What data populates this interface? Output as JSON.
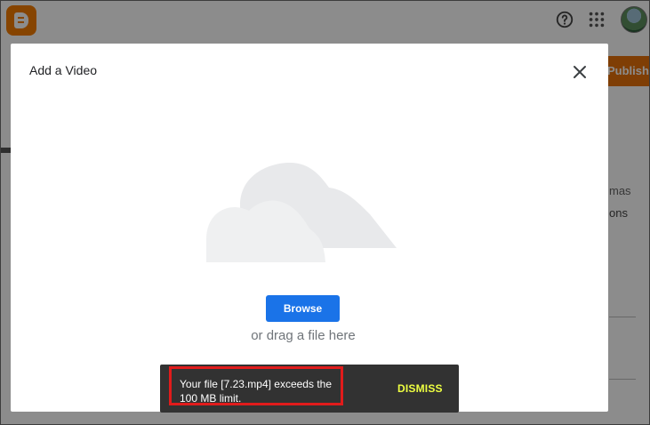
{
  "background": {
    "publish_label": "Publish",
    "partial_text_1": "mas",
    "partial_text_2": "ons"
  },
  "icons": {
    "help": "help-circle-icon",
    "apps": "apps-grid-icon",
    "close": "close-icon",
    "cloud": "cloud-upload-illustration"
  },
  "dialog": {
    "title": "Add a Video",
    "browse_label": "Browse",
    "drag_text": "or drag a file here"
  },
  "snackbar": {
    "message": "Your file [7.23.mp4] exceeds the 100 MB limit.",
    "dismiss_label": "DISMISS"
  },
  "colors": {
    "accent": "#1a73e8",
    "brand": "#f57c00",
    "publish": "#e8710a",
    "highlight": "#e11b1b",
    "dismiss": "#eeff41"
  }
}
